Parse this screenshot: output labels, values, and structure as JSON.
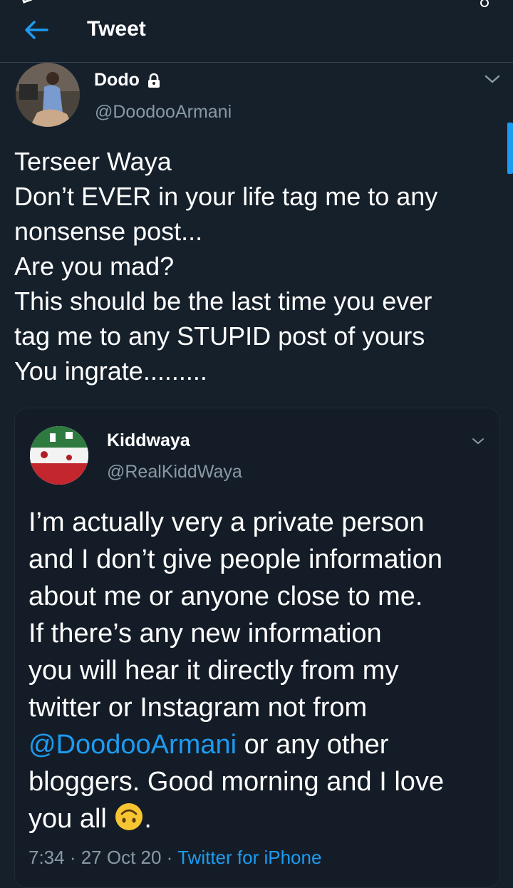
{
  "header": {
    "title": "Tweet"
  },
  "tweet": {
    "author_name": "Dodo",
    "author_handle": "@DoodooArmani",
    "lines": [
      "Terseer Waya",
      "Don’t EVER in your life tag me to any",
      "nonsense post...",
      "Are you mad?",
      "This should be the last time you ever",
      "tag me to any STUPID post of yours",
      "You ingrate........."
    ]
  },
  "quoted": {
    "author_name": "Kiddwaya",
    "author_handle": "@RealKiddWaya",
    "lines": [
      "I’m actually very a private person",
      "and I don’t give people information",
      "about me or anyone close to me.",
      "If there’s any new information",
      "you will hear it directly from my",
      "twitter or Instagram not from"
    ],
    "mention": "@DoodooArmani",
    "mention_suffix": " or any other",
    "line_after_mention": "bloggers. Good morning and I love",
    "last_line_prefix": "you all ",
    "last_line_suffix": ".",
    "emoji": "upside-down-face-icon",
    "time": "7:34",
    "separator": " · ",
    "date": "27 Oct 20",
    "source": "Twitter for iPhone"
  },
  "colors": {
    "background": "#15202b",
    "accent": "#1d9bf0",
    "secondary_text": "#8899a6"
  }
}
